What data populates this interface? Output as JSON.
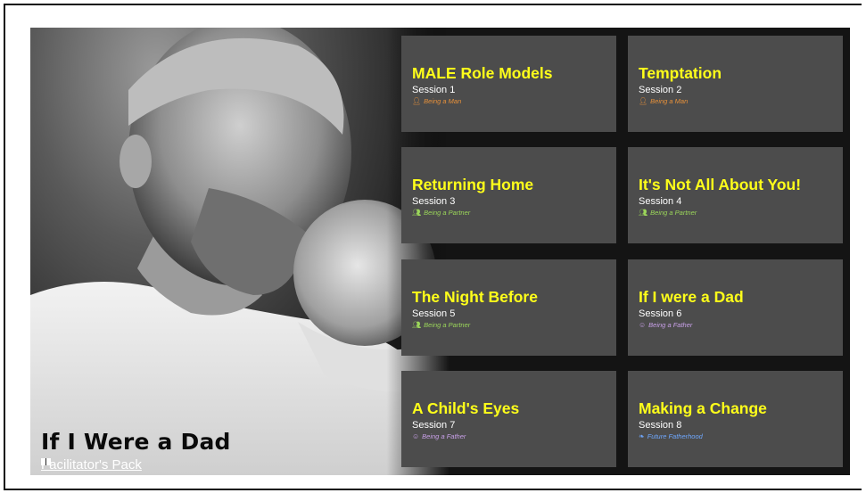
{
  "hero": {
    "title": "If I Were a Dad",
    "pack_link": "Facilitator's Pack",
    "pack_icon": "book-icon"
  },
  "sessions": [
    {
      "title": "MALE Role Models",
      "session": "Session 1",
      "tag": "Being a Man",
      "tag_icon": "man-icon",
      "tag_color": "#e8913a"
    },
    {
      "title": "Temptation",
      "session": "Session 2",
      "tag": "Being a Man",
      "tag_icon": "man-icon",
      "tag_color": "#e8913a"
    },
    {
      "title": "Returning Home",
      "session": "Session 3",
      "tag": "Being a Partner",
      "tag_icon": "couple-icon",
      "tag_color": "#9bd65a"
    },
    {
      "title": "It's Not All About You!",
      "session": "Session 4",
      "tag": "Being a Partner",
      "tag_icon": "couple-icon",
      "tag_color": "#9bd65a"
    },
    {
      "title": "The Night Before",
      "session": "Session 5",
      "tag": "Being a Partner",
      "tag_icon": "couple-icon",
      "tag_color": "#9bd65a"
    },
    {
      "title": "If I were a Dad",
      "session": "Session 6",
      "tag": "Being a Father",
      "tag_icon": "baby-icon",
      "tag_color": "#c8a0e8"
    },
    {
      "title": "A Child's Eyes",
      "session": "Session 7",
      "tag": "Being a Father",
      "tag_icon": "baby-icon",
      "tag_color": "#c8a0e8"
    },
    {
      "title": "Making a Change",
      "session": "Session 8",
      "tag": "Future Fatherhood",
      "tag_icon": "footprint-icon",
      "tag_color": "#6fa8ff"
    }
  ],
  "colors": {
    "card_bg": "#4c4c4c",
    "title_yellow": "#ffff1a",
    "banner_bg": "#141414"
  }
}
